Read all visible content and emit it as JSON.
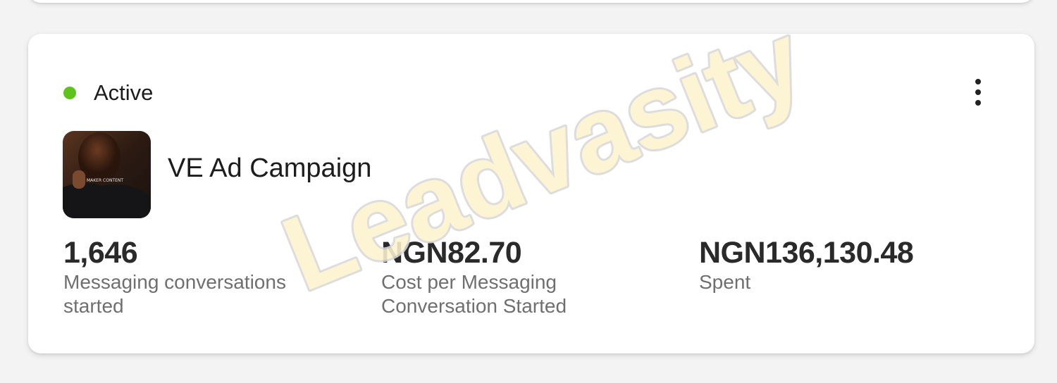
{
  "campaign": {
    "status": "Active",
    "status_color": "#5cc41a",
    "name": "VE Ad Campaign",
    "thumbnail_caption": "MAKER CONTENT",
    "menu_icon": "more-vertical-icon"
  },
  "metrics": [
    {
      "value": "1,646",
      "label": "Messaging conversations started"
    },
    {
      "value": "NGN82.70",
      "label": "Cost per Messaging Conversation Started"
    },
    {
      "value": "NGN136,130.48",
      "label": "Spent"
    }
  ],
  "watermark": {
    "text": "Leadvasity",
    "fill": "#fdf3cf",
    "stroke": "#d9d9d9"
  }
}
